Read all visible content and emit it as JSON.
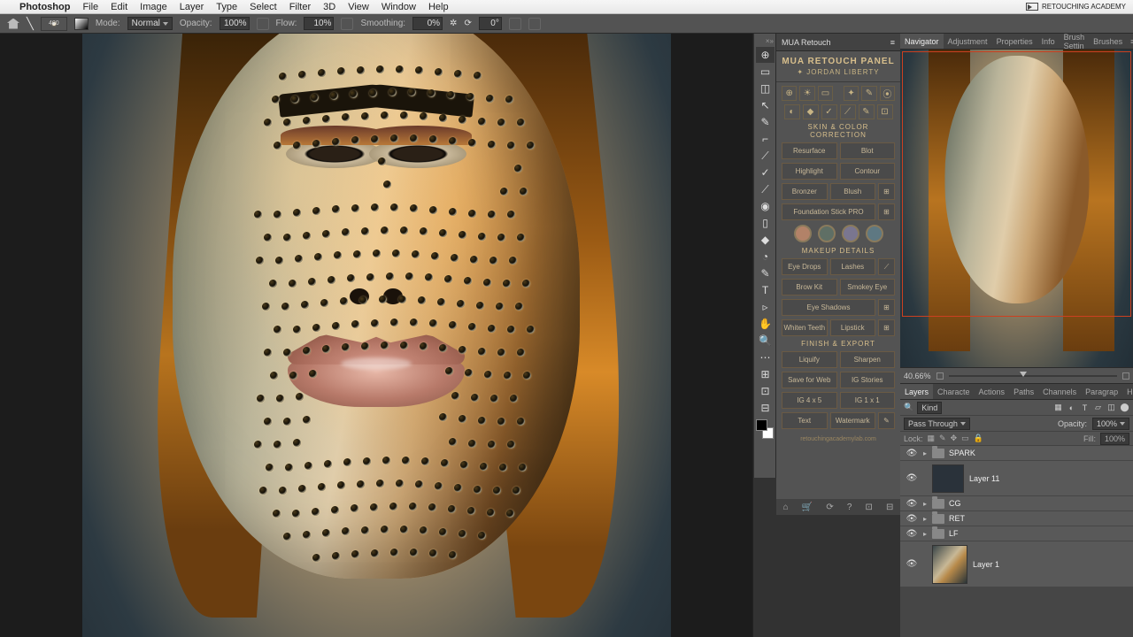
{
  "menubar": {
    "app": "Photoshop",
    "items": [
      "File",
      "Edit",
      "Image",
      "Layer",
      "Type",
      "Select",
      "Filter",
      "3D",
      "View",
      "Window",
      "Help"
    ],
    "corner": "RETOUCHING ACADEMY"
  },
  "optbar": {
    "brush_size": "400",
    "mode_label": "Mode:",
    "mode_value": "Normal",
    "opacity_label": "Opacity:",
    "opacity_value": "100%",
    "flow_label": "Flow:",
    "flow_value": "10%",
    "smoothing_label": "Smoothing:",
    "smoothing_value": "0%",
    "angle": "0°"
  },
  "tools": [
    "⊕",
    "▭",
    "◫",
    "↖",
    "✎",
    "⌐",
    "⟋",
    "✓",
    "⟋",
    "◉",
    "▯",
    "◆",
    "◔",
    "✎",
    "T",
    "▹",
    "✋",
    "🔍",
    "⋯",
    "⊞",
    "⊡",
    "⊟"
  ],
  "mua": {
    "tab": "MUA Retouch",
    "title": "MUA RETOUCH PANEL",
    "subtitle": "✦ JORDAN LIBERTY",
    "section_skin": "SKIN & COLOR CORRECTION",
    "resurface": "Resurface",
    "blot": "Blot",
    "highlight": "Highlight",
    "contour": "Contour",
    "bronzer": "Bronzer",
    "blush": "Blush",
    "foundation": "Foundation Stick PRO",
    "section_makeup": "MAKEUP DETAILS",
    "eyedrops": "Eye Drops",
    "lashes": "Lashes",
    "browkit": "Brow Kit",
    "smokey": "Smokey Eye",
    "eyeshadows": "Eye Shadows",
    "whiten": "Whiten Teeth",
    "lipstick": "Lipstick",
    "section_finish": "FINISH & EXPORT",
    "liquify": "Liquify",
    "sharpen": "Sharpen",
    "saveweb": "Save for Web",
    "igstories": "IG Stories",
    "ig45": "IG 4 x 5",
    "ig11": "IG 1 x 1",
    "text": "Text",
    "watermark": "Watermark",
    "footer": "retouchingacademylab.com",
    "swatches": [
      "#b28268",
      "#5f6f65",
      "#7a7690",
      "#5e7882"
    ]
  },
  "right_tabs_top": [
    "Navigator",
    "Adjustment",
    "Properties",
    "Info",
    "Brush Settin",
    "Brushes"
  ],
  "zoom": "40.66%",
  "right_tabs_bot": [
    "Layers",
    "Characte",
    "Actions",
    "Paths",
    "Channels",
    "Paragrap",
    "History"
  ],
  "layers": {
    "filter": "Kind",
    "blend": "Pass Through",
    "opacity_label": "Opacity:",
    "opacity": "100%",
    "lock_label": "Lock:",
    "fill_label": "Fill:",
    "fill": "100%",
    "list": [
      {
        "name": "SPARK",
        "type": "group"
      },
      {
        "name": "Layer 11",
        "type": "layer"
      },
      {
        "name": "CG",
        "type": "group"
      },
      {
        "name": "RET",
        "type": "group"
      },
      {
        "name": "LF",
        "type": "group"
      },
      {
        "name": "Layer 1",
        "type": "image"
      }
    ]
  }
}
